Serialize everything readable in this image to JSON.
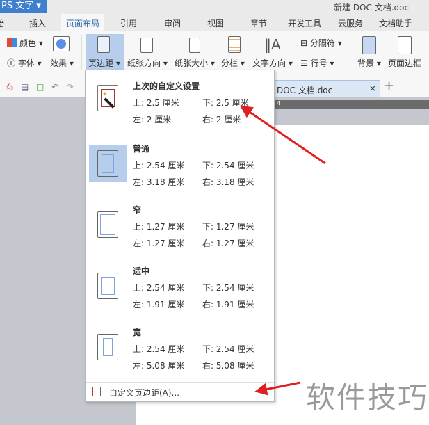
{
  "app": {
    "button": "PS 文字",
    "doc_title": "新建 DOC 文档.doc -"
  },
  "tabs": [
    "始",
    "插入",
    "页面布局",
    "引用",
    "审阅",
    "视图",
    "章节",
    "开发工具",
    "云服务",
    "文档助手"
  ],
  "ribbon": {
    "color": "颜色",
    "font": "字体",
    "effect": "效果",
    "margins": "页边距",
    "orientation": "纸张方向",
    "size": "纸张大小",
    "columns": "分栏",
    "text_dir": "文字方向",
    "breaks": "分隔符",
    "line_num": "行号",
    "background": "背景",
    "page_border": "页面边框"
  },
  "doc_tab": {
    "label": "DOC 文档.doc",
    "close": "×",
    "add": "+"
  },
  "ruler": "4",
  "menu": {
    "items": [
      {
        "name": "上次的自定义设置",
        "top": "上: 2.5 厘米",
        "bottom": "下: 2.5 厘米",
        "left": "左: 2 厘米",
        "right": "右: 2 厘米"
      },
      {
        "name": "普通",
        "top": "上: 2.54 厘米",
        "bottom": "下: 2.54 厘米",
        "left": "左: 3.18 厘米",
        "right": "右: 3.18 厘米"
      },
      {
        "name": "窄",
        "top": "上: 1.27 厘米",
        "bottom": "下: 1.27 厘米",
        "left": "左: 1.27 厘米",
        "right": "右: 1.27 厘米"
      },
      {
        "name": "适中",
        "top": "上: 2.54 厘米",
        "bottom": "下: 2.54 厘米",
        "left": "左: 1.91 厘米",
        "right": "右: 1.91 厘米"
      },
      {
        "name": "宽",
        "top": "上: 2.54 厘米",
        "bottom": "下: 2.54 厘米",
        "left": "左: 5.08 厘米",
        "right": "右: 5.08 厘米"
      }
    ],
    "custom": "自定义页边距(A)..."
  },
  "watermark": "软件技巧",
  "colors": {
    "accent": "#3f7fcf",
    "selected": "#b6cdeb",
    "arrow": "#e02020"
  }
}
